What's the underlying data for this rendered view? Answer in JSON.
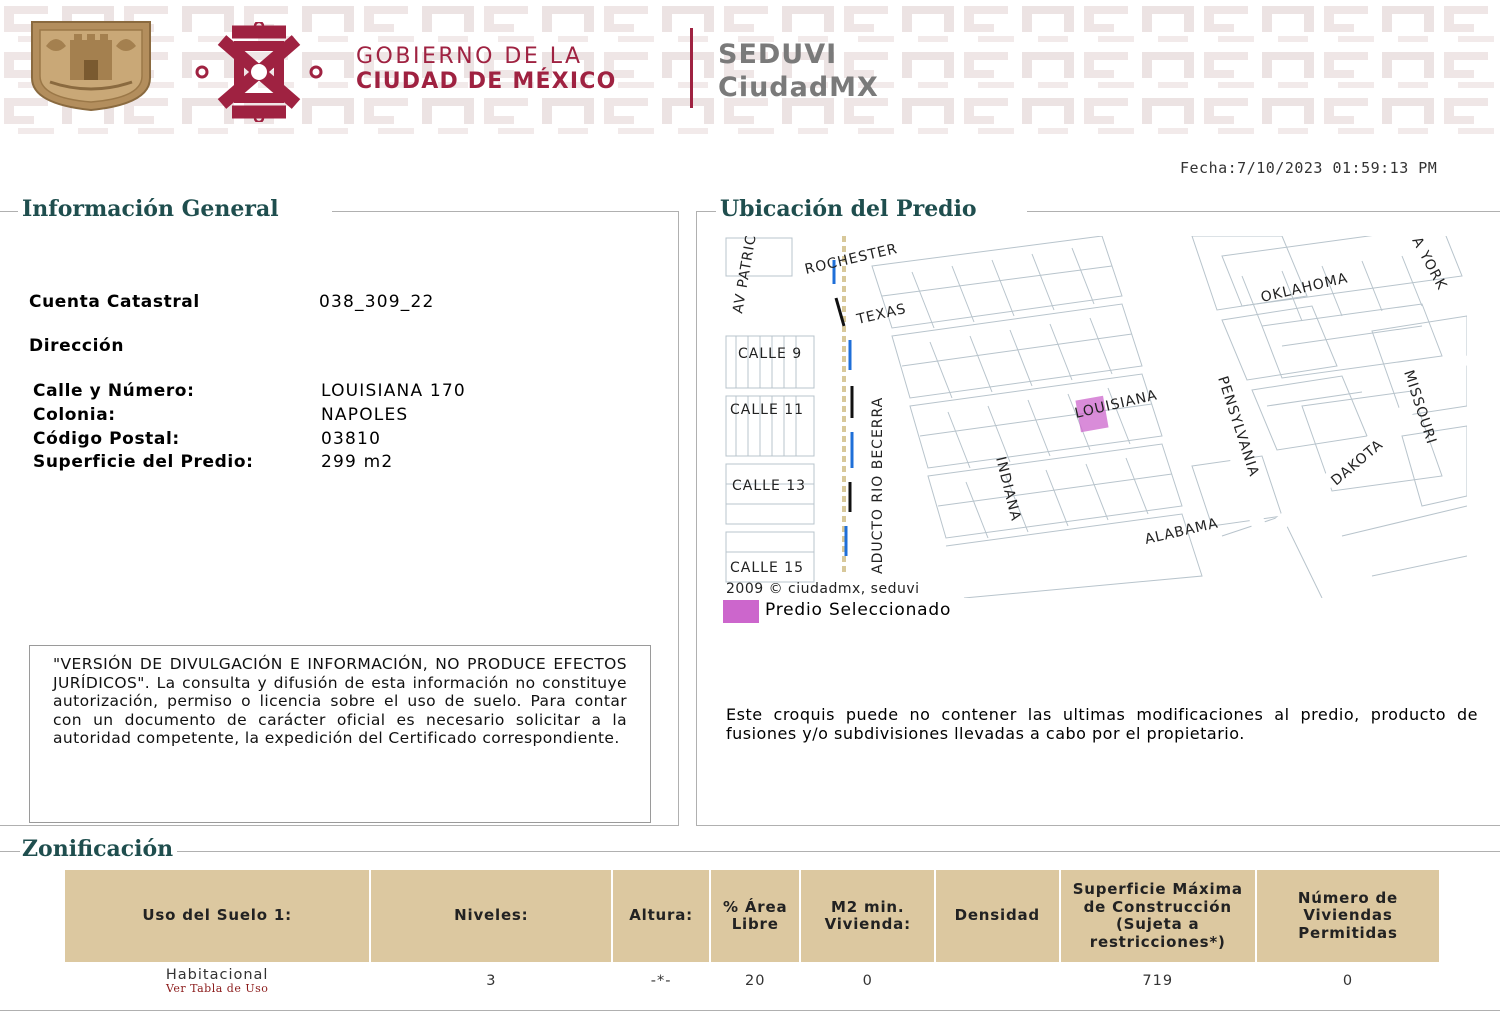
{
  "header": {
    "gobierno_line1": "GOBIERNO DE LA",
    "gobierno_line2": "CIUDAD DE MÉXICO",
    "seduvi_line1": "SEDUVI",
    "seduvi_line2": "CiudadMX",
    "brand_color": "#9f2241",
    "gold_color": "#b38e5d"
  },
  "fecha": "Fecha:7/10/2023 01:59:13 PM",
  "info_general": {
    "legend": "Información General",
    "cuenta_label": "Cuenta Catastral",
    "cuenta_value": "038_309_22",
    "direccion_label": "Dirección",
    "calle_label": "Calle y Número:",
    "calle_value": "LOUISIANA 170",
    "colonia_label": "Colonia:",
    "colonia_value": "NAPOLES",
    "cp_label": "Código Postal:",
    "cp_value": "03810",
    "superficie_label": "Superficie del Predio:",
    "superficie_value": "299 m2",
    "disclaimer": "\"VERSIÓN DE DIVULGACIÓN E INFORMACIÓN, NO PRODUCE EFECTOS JURÍDICOS\". La consulta y difusión de esta información no constituye autorización, permiso o licencia sobre el uso de suelo. Para contar con un documento de carácter oficial es necesario solicitar a la autoridad competente, la expedición del Certificado correspondiente."
  },
  "ubicacion": {
    "legend": "Ubicación del Predio",
    "map_labels": {
      "patricio": "AV PATRIC",
      "rochester": "ROCHESTER",
      "york": "A YORK",
      "oklahoma": "OKLAHOMA",
      "texas": "TEXAS",
      "calle9": "CALLE 9",
      "calle11": "CALLE 11",
      "calle13": "CALLE 13",
      "calle15": "CALLE 15",
      "louisiana": "LOUISIANA",
      "pensylvania": "PENSYLVANIA",
      "missouri": "MISSOURI",
      "dakota": "DAKOTA",
      "indiana": "INDIANA",
      "alabama": "ALABAMA",
      "becerra": "ADUCTO RIO BECERRA",
      "copyright": "2009 © ciudadmx, seduvi"
    },
    "predio_label": "Predio Seleccionado",
    "predio_color": "#cc66cc",
    "croquis_note": "Este croquis puede no contener las ultimas modificaciones al predio, producto de fusiones y/o subdivisiones llevadas a cabo por el propietario."
  },
  "zonificacion": {
    "legend": "Zonificación",
    "headers": {
      "uso": "Uso del Suelo 1:",
      "niveles": "Niveles:",
      "altura": "Altura:",
      "area_libre": "% Área Libre",
      "m2_min": "M2 min. Vivienda:",
      "densidad": "Densidad",
      "superficie_max": "Superficie Máxima de Construcción (Sujeta a restricciones*)",
      "num_viviendas": "Número de Viviendas Permitidas"
    },
    "row": {
      "uso": "Habitacional",
      "uso_link": "Ver Tabla de Uso",
      "niveles": "3",
      "altura": "-*-",
      "area_libre": "20",
      "m2_min": "0",
      "densidad": "",
      "superficie_max": "719",
      "num_viviendas": "0"
    }
  }
}
